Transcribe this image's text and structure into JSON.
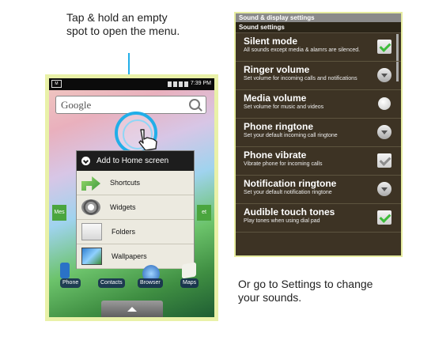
{
  "captions": {
    "top": "Tap & hold an empty spot to open the menu.",
    "bottom": "Or go to Settings to change your sounds."
  },
  "phone": {
    "status_time": "7:39 PM",
    "status_left_icon_text": "M",
    "search_label": "Google",
    "menu": {
      "header": "Add to Home screen",
      "items": [
        {
          "label": "Shortcuts",
          "icon": "shortcuts-icon"
        },
        {
          "label": "Widgets",
          "icon": "widgets-icon"
        },
        {
          "label": "Folders",
          "icon": "folders-icon"
        },
        {
          "label": "Wallpapers",
          "icon": "wallpapers-icon"
        }
      ]
    },
    "side_tabs": {
      "left": "Mes",
      "right": "et"
    },
    "dock": {
      "phone": "Phone",
      "contacts": "Contacts",
      "browser": "Browser",
      "maps": "Maps"
    },
    "accent_color": "#22aee8"
  },
  "settings": {
    "title": "Sound & display settings",
    "section": "Sound settings",
    "rows": [
      {
        "title": "Silent mode",
        "subtitle": "All sounds except media & alamrs are silenced.",
        "control": "checkbox-on"
      },
      {
        "title": "Ringer volume",
        "subtitle": "Set volume for incoming calls and notifications",
        "control": "dropdown"
      },
      {
        "title": "Media volume",
        "subtitle": "Set volume for music and videos",
        "control": "radio"
      },
      {
        "title": "Phone ringtone",
        "subtitle": "Set your default incoming call ringtone",
        "control": "dropdown"
      },
      {
        "title": "Phone vibrate",
        "subtitle": "Vibrate phone for incoming calls",
        "control": "checkbox-off"
      },
      {
        "title": "Notification ringtone",
        "subtitle": "Set your default notification ringtone",
        "control": "dropdown"
      },
      {
        "title": "Audible touch tones",
        "subtitle": "Play tones when using dial pad",
        "control": "checkbox-on"
      }
    ]
  }
}
